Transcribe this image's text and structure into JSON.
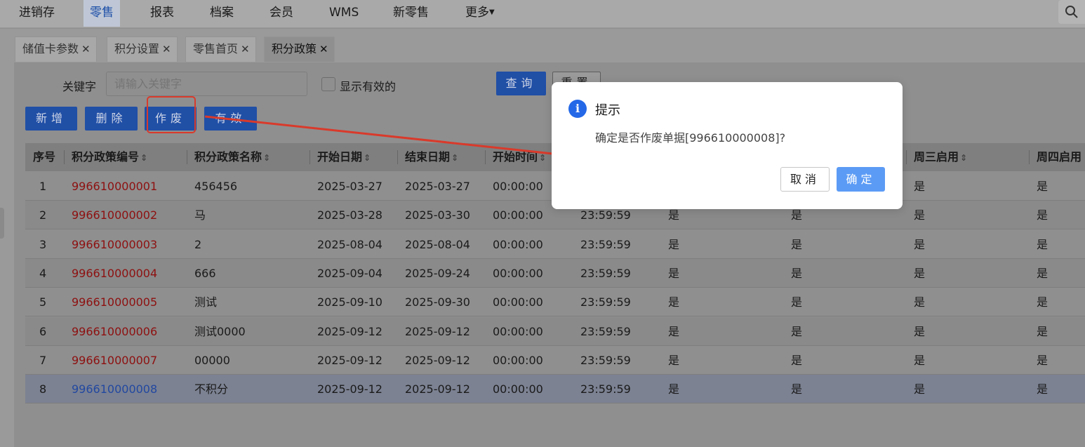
{
  "nav": {
    "items": [
      "进销存",
      "零售",
      "报表",
      "档案",
      "会员",
      "WMS",
      "新零售",
      "更多"
    ],
    "active": "零售",
    "more_icon": "caret-down-icon",
    "search_icon": "search-icon"
  },
  "tabs": [
    {
      "label": "储值卡参数",
      "close": "✕"
    },
    {
      "label": "积分设置",
      "close": "✕"
    },
    {
      "label": "零售首页",
      "close": "✕"
    },
    {
      "label": "积分政策",
      "close": "✕",
      "active": true
    }
  ],
  "filter": {
    "keyword_label": "关键字",
    "keyword_placeholder": "请输入关键字",
    "keyword_value": "",
    "show_valid_label": "显示有效的",
    "show_valid_checked": false,
    "query_button": "查询",
    "reset_button": "重置"
  },
  "toolbar": {
    "add": "新增",
    "delete": "删除",
    "void": "作废",
    "valid": "有效"
  },
  "table": {
    "headers": [
      "序号",
      "积分政策编号",
      "积分政策名称",
      "开始日期",
      "结束日期",
      "开始时间",
      "",
      "",
      "",
      "周三启用",
      "周四启用"
    ],
    "rows": [
      {
        "no": "1",
        "code": "996610000001",
        "name": "456456",
        "start_date": "2025-03-27",
        "end_date": "2025-03-27",
        "start_time": "00:00:00",
        "end_time": "",
        "c7": "",
        "c8": "",
        "wed": "是",
        "thu": "是"
      },
      {
        "no": "2",
        "code": "996610000002",
        "name": "马",
        "start_date": "2025-03-28",
        "end_date": "2025-03-30",
        "start_time": "00:00:00",
        "end_time": "23:59:59",
        "c7": "是",
        "c8": "是",
        "wed": "是",
        "thu": "是"
      },
      {
        "no": "3",
        "code": "996610000003",
        "name": "2",
        "start_date": "2025-08-04",
        "end_date": "2025-08-04",
        "start_time": "00:00:00",
        "end_time": "23:59:59",
        "c7": "是",
        "c8": "是",
        "wed": "是",
        "thu": "是"
      },
      {
        "no": "4",
        "code": "996610000004",
        "name": "666",
        "start_date": "2025-09-04",
        "end_date": "2025-09-24",
        "start_time": "00:00:00",
        "end_time": "23:59:59",
        "c7": "是",
        "c8": "是",
        "wed": "是",
        "thu": "是"
      },
      {
        "no": "5",
        "code": "996610000005",
        "name": "测试",
        "start_date": "2025-09-10",
        "end_date": "2025-09-30",
        "start_time": "00:00:00",
        "end_time": "23:59:59",
        "c7": "是",
        "c8": "是",
        "wed": "是",
        "thu": "是"
      },
      {
        "no": "6",
        "code": "996610000006",
        "name": "测试0000",
        "start_date": "2025-09-12",
        "end_date": "2025-09-12",
        "start_time": "00:00:00",
        "end_time": "23:59:59",
        "c7": "是",
        "c8": "是",
        "wed": "是",
        "thu": "是"
      },
      {
        "no": "7",
        "code": "996610000007",
        "name": "00000",
        "start_date": "2025-09-12",
        "end_date": "2025-09-12",
        "start_time": "00:00:00",
        "end_time": "23:59:59",
        "c7": "是",
        "c8": "是",
        "wed": "是",
        "thu": "是"
      },
      {
        "no": "8",
        "code": "996610000008",
        "name": "不积分",
        "start_date": "2025-09-12",
        "end_date": "2025-09-12",
        "start_time": "00:00:00",
        "end_time": "23:59:59",
        "c7": "是",
        "c8": "是",
        "wed": "是",
        "thu": "是",
        "selected": true
      }
    ]
  },
  "dialog": {
    "icon": "info-icon",
    "icon_glyph": "i",
    "title": "提示",
    "message": "确定是否作废单据[996610000008]?",
    "cancel": "取消",
    "ok": "确定"
  },
  "colors": {
    "primary": "#2468e8",
    "code_red": "#8e1010",
    "annotation_red": "#d93a2b"
  }
}
